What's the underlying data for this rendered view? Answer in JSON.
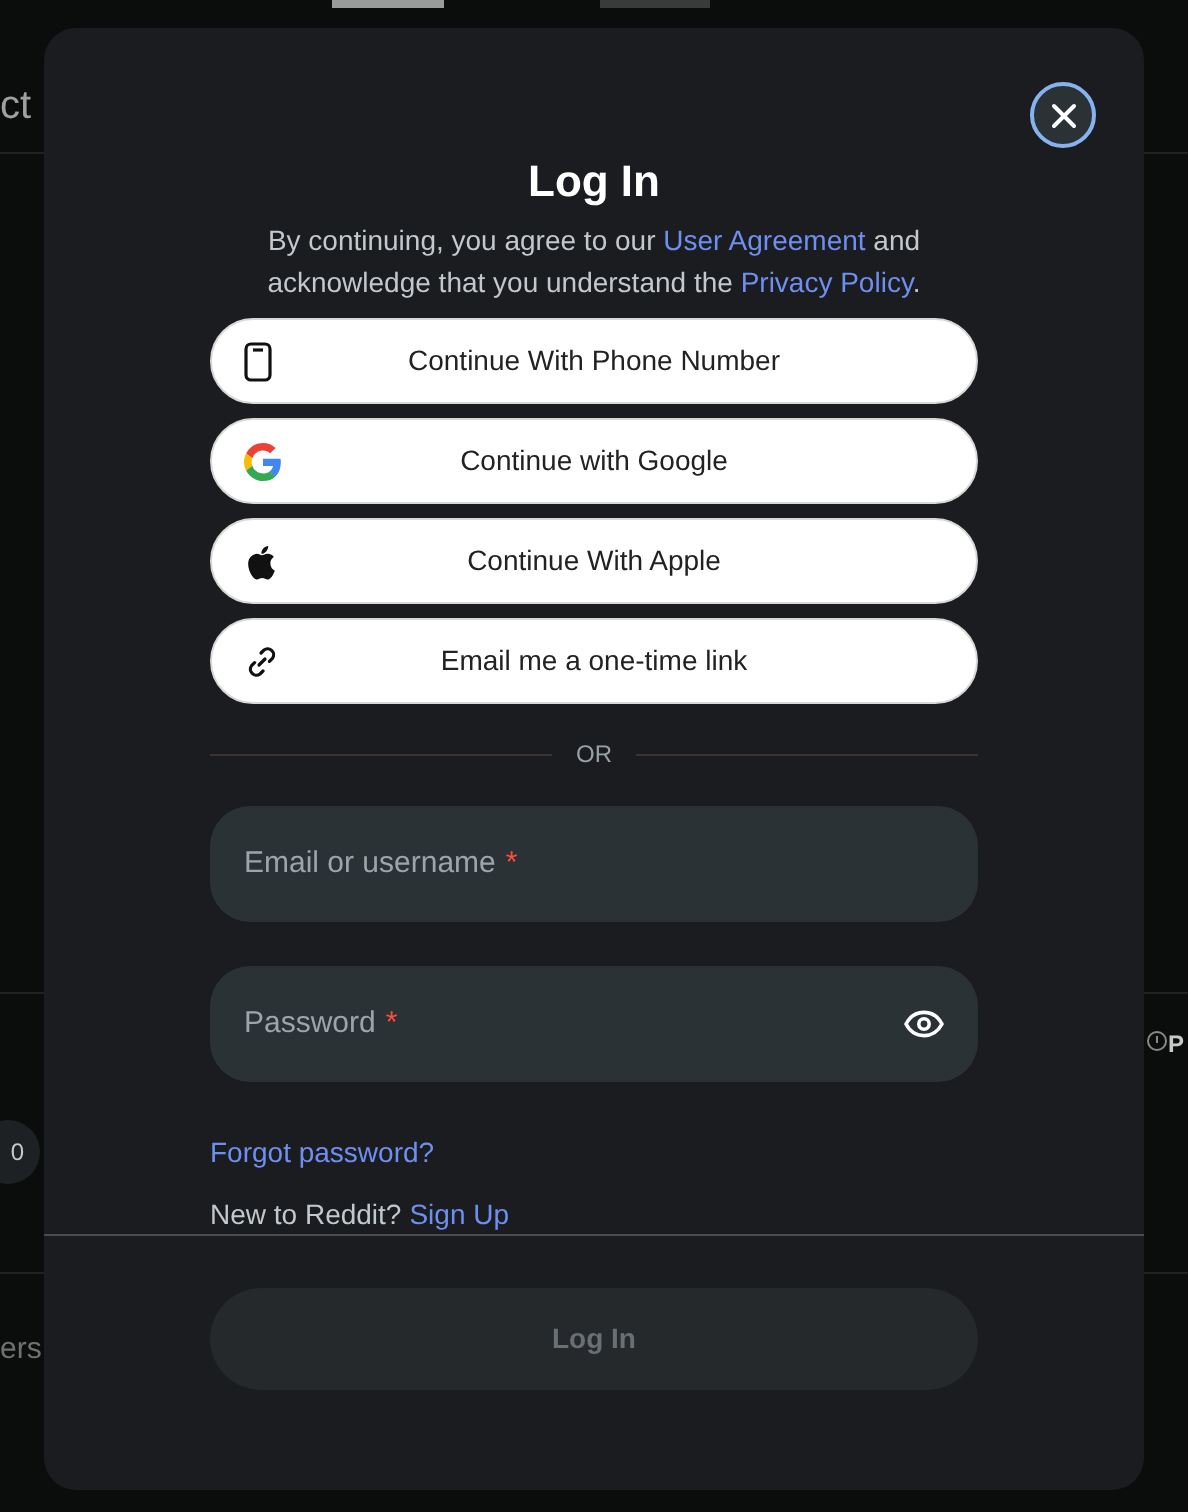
{
  "background": {
    "fragments": [
      {
        "kind": "top-left",
        "text": "ct"
      },
      {
        "kind": "badge",
        "text": "0"
      },
      {
        "kind": "right",
        "text": "P"
      },
      {
        "kind": "bottom-left",
        "text": "ers"
      }
    ]
  },
  "dialog": {
    "title": "Log In",
    "intro": [
      {
        "kind": "text",
        "text": "By continuing, you agree to our "
      },
      {
        "kind": "link",
        "text": "User Agreement"
      },
      {
        "kind": "text",
        "text": " and acknowledge that you understand the "
      },
      {
        "kind": "link",
        "text": "Privacy Policy"
      },
      {
        "kind": "text",
        "text": "."
      }
    ],
    "providers": [
      {
        "kind": "phone",
        "label": "Continue With Phone Number"
      },
      {
        "kind": "google",
        "label": "Continue with Google"
      },
      {
        "kind": "apple",
        "label": "Continue With Apple"
      },
      {
        "kind": "link",
        "label": "Email me a one-time link"
      }
    ],
    "separator": "OR",
    "fields": [
      {
        "kind": "text",
        "placeholder": "Email or username",
        "required": true,
        "required_mark": "*"
      },
      {
        "kind": "password",
        "placeholder": "Password",
        "required": true,
        "required_mark": "*"
      }
    ],
    "forgot_link": "Forgot password?",
    "signup": {
      "text": "New to Reddit?",
      "link": "Sign Up"
    },
    "submit": {
      "label": "Log In",
      "disabled": true
    }
  }
}
